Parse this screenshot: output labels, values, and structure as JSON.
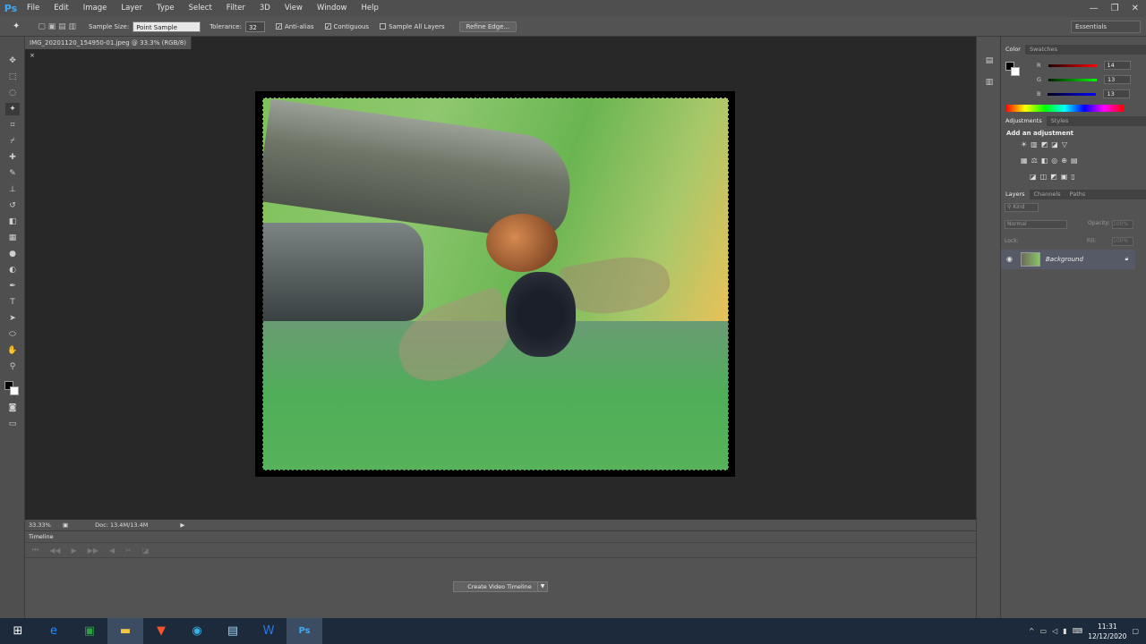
{
  "app": {
    "logo": "Ps"
  },
  "menu": [
    "File",
    "Edit",
    "Image",
    "Layer",
    "Type",
    "Select",
    "Filter",
    "3D",
    "View",
    "Window",
    "Help"
  ],
  "window_controls": [
    "—",
    "❐",
    "✕"
  ],
  "options": {
    "sample_size_label": "Sample Size:",
    "sample_size_value": "Point Sample",
    "tolerance_label": "Tolerance:",
    "tolerance_value": "32",
    "antialias": "Anti-alias",
    "contiguous": "Contiguous",
    "sample_all_layers": "Sample All Layers",
    "refine_edge": "Refine Edge...",
    "workspace": "Essentials"
  },
  "document": {
    "tab_title": "IMG_20201120_154950-01.jpeg @ 33.3% (RGB/8)",
    "zoom": "33.33%",
    "doc_size": "Doc: 13.4M/13.4M"
  },
  "timeline": {
    "tab": "Timeline",
    "create_button": "Create Video Timeline"
  },
  "color_panel": {
    "tabs": [
      "Color",
      "Swatches"
    ],
    "r_label": "R",
    "r_value": "14",
    "g_label": "G",
    "g_value": "13",
    "b_label": "B",
    "b_value": "13"
  },
  "adjustments_panel": {
    "tabs": [
      "Adjustments",
      "Styles"
    ],
    "title": "Add an adjustment"
  },
  "layers_panel": {
    "tabs": [
      "Layers",
      "Channels",
      "Paths"
    ],
    "kind": "Kind",
    "blend_mode": "Normal",
    "opacity_label": "Opacity:",
    "opacity_value": "100%",
    "lock_label": "Lock:",
    "fill_label": "Fill:",
    "fill_value": "100%",
    "layer_name": "Background"
  },
  "taskbar": {
    "time": "11:31",
    "date": "12/12/2020"
  },
  "colors": {
    "accent": "#3da9f5",
    "taskbar": "#1c2a3c"
  }
}
